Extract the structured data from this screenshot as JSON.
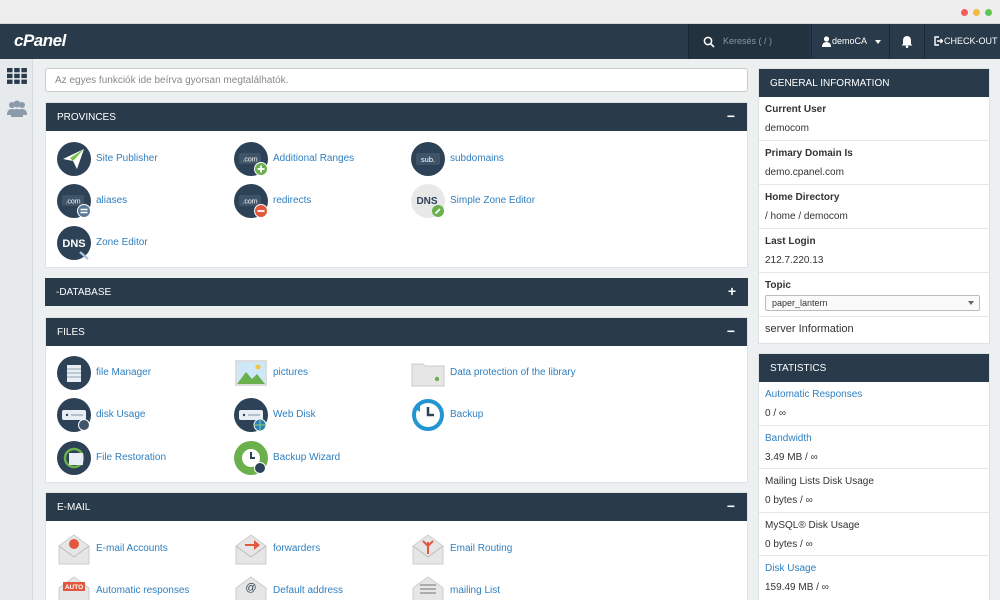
{
  "app": {
    "logo": "cPanel"
  },
  "header": {
    "search_placeholder": "Keresés ( / )",
    "user": "demoCA",
    "checkout": "CHECK-OUT"
  },
  "quick_search": {
    "placeholder": "Az egyes funkciók ide beírva gyorsan megtalálhatók."
  },
  "sections": {
    "provinces": {
      "title": "PROVINCES",
      "toggle": "−",
      "items": [
        {
          "label": "Site Publisher",
          "icon": "paper-plane-icon"
        },
        {
          "label": "Additional Ranges",
          "icon": "com-add-icon"
        },
        {
          "label": "subdomains",
          "icon": "sub-domain-icon"
        },
        {
          "label": "aliases",
          "icon": "com-alias-icon"
        },
        {
          "label": "redirects",
          "icon": "com-redirect-icon"
        },
        {
          "label": "Simple Zone Editor",
          "icon": "dns-simple-icon"
        },
        {
          "label": "Zone Editor",
          "icon": "dns-zone-icon"
        }
      ]
    },
    "database": {
      "title": "-DATABASE",
      "toggle": "+"
    },
    "files": {
      "title": "FILES",
      "toggle": "−",
      "items": [
        {
          "label": "file Manager",
          "icon": "file-manager-icon"
        },
        {
          "label": "pictures",
          "icon": "pictures-icon"
        },
        {
          "label": "Data protection of the library",
          "icon": "folder-protect-icon"
        },
        {
          "label": "disk Usage",
          "icon": "disk-usage-icon"
        },
        {
          "label": "Web Disk",
          "icon": "web-disk-icon"
        },
        {
          "label": "Backup",
          "icon": "backup-icon"
        },
        {
          "label": "File Restoration",
          "icon": "file-restore-icon"
        },
        {
          "label": "Backup Wizard",
          "icon": "backup-wizard-icon"
        }
      ]
    },
    "email": {
      "title": "E-MAIL",
      "toggle": "−",
      "items": [
        {
          "label": "E-mail Accounts",
          "icon": "email-accounts-icon"
        },
        {
          "label": "forwarders",
          "icon": "forwarders-icon"
        },
        {
          "label": "Email Routing",
          "icon": "email-routing-icon"
        },
        {
          "label": "Automatic responses",
          "icon": "auto-responder-icon"
        },
        {
          "label": "Default address",
          "icon": "default-address-icon"
        },
        {
          "label": "mailing List",
          "icon": "mailing-list-icon"
        }
      ]
    }
  },
  "general_info": {
    "title": "GENERAL INFORMATION",
    "current_user_label": "Current User",
    "current_user": "democom",
    "primary_domain_label": "Primary Domain Is",
    "primary_domain": "demo.cpanel.com",
    "home_dir_label": "Home Directory",
    "home_dir": "/ home / democom",
    "last_login_label": "Last Login",
    "last_login": "212.7.220.13",
    "topic_label": "Topic",
    "topic_value": "paper_lantern",
    "server_info": "server Information"
  },
  "statistics": {
    "title": "STATISTICS",
    "rows": [
      {
        "label": "Automatic Responses",
        "value": "0 / ∞",
        "link": true
      },
      {
        "label": "Bandwidth",
        "value": "3.49 MB / ∞",
        "link": true
      },
      {
        "label": "Mailing Lists Disk Usage",
        "value": "0 bytes / ∞",
        "link": false
      },
      {
        "label": "MySQL® Disk Usage",
        "value": "0 bytes / ∞",
        "link": false
      },
      {
        "label": "Disk Usage",
        "value": "159.49 MB / ∞",
        "link": true
      }
    ]
  },
  "colors": {
    "header": "#293a4a",
    "link": "#2f7fbf",
    "background": "#ecf0f1"
  }
}
